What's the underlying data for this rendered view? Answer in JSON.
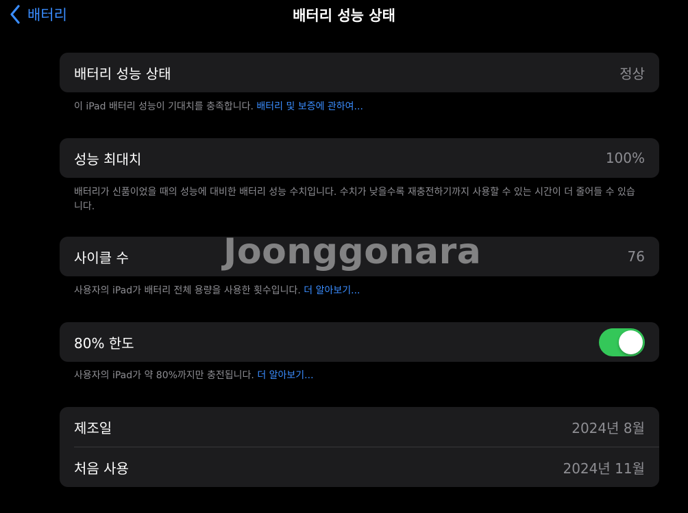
{
  "nav": {
    "back_label": "배터리",
    "title": "배터리 성능 상태"
  },
  "health": {
    "label": "배터리 성능 상태",
    "value": "정상",
    "note": "이 iPad 배터리 성능이 기대치를 충족합니다.",
    "link": "배터리 및 보증에 관하여..."
  },
  "max_capacity": {
    "label": "성능 최대치",
    "value": "100%",
    "note": "배터리가 신품이었을 때의 성능에 대비한 배터리 성능 수치입니다. 수치가 낮을수록 재충전하기까지 사용할 수 있는 시간이 더 줄어들 수 있습니다."
  },
  "cycle_count": {
    "label": "사이클 수",
    "value": "76",
    "note": "사용자의 iPad가 배터리 전체 용량을 사용한 횟수입니다.",
    "link": "더 알아보기..."
  },
  "limit_80": {
    "label": "80% 한도",
    "enabled": true,
    "note": "사용자의 iPad가 약 80%까지만 충전됩니다.",
    "link": "더 알아보기..."
  },
  "dates": {
    "manufacture_label": "제조일",
    "manufacture_value": "2024년 8월",
    "first_use_label": "처음 사용",
    "first_use_value": "2024년 11월"
  },
  "watermark": "Joonggonara",
  "colors": {
    "accent": "#3a8dff",
    "toggle_on": "#34c759",
    "card_bg": "#1c1c1e",
    "secondary_text": "#8e8e93"
  }
}
